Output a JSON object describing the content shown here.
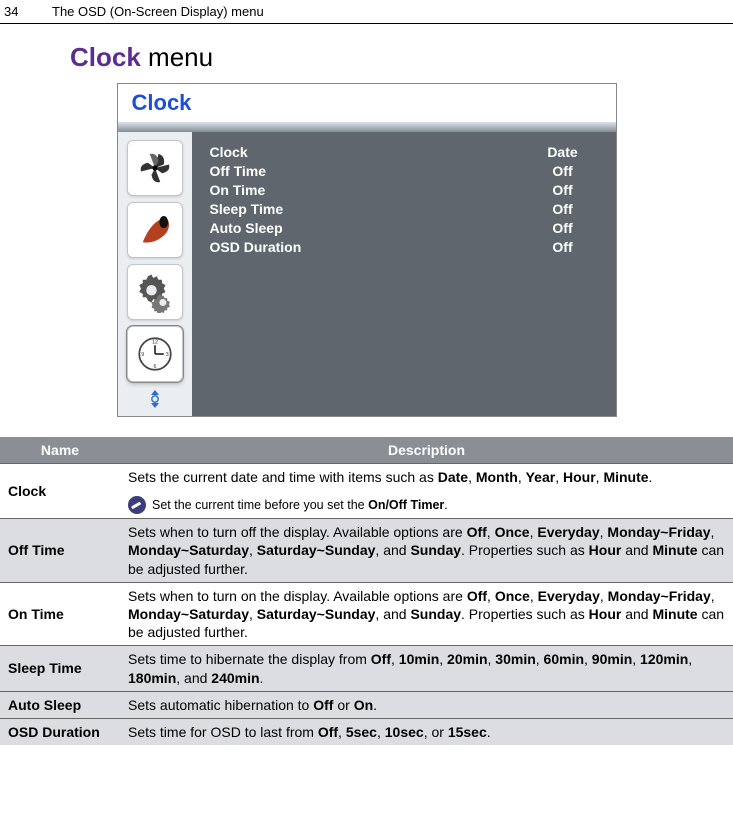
{
  "header": {
    "page_number": "34",
    "chapter": "The OSD (On-Screen Display) menu"
  },
  "section": {
    "accent": "Clock",
    "rest": " menu"
  },
  "osd": {
    "title": "Clock",
    "icons": [
      "fan-icon",
      "calibration-icon",
      "settings-icon",
      "clock-icon"
    ],
    "items": [
      {
        "label": "Clock",
        "value": "Date"
      },
      {
        "label": "Off Time",
        "value": "Off"
      },
      {
        "label": "On Time",
        "value": "Off"
      },
      {
        "label": "Sleep Time",
        "value": "Off"
      },
      {
        "label": "Auto Sleep",
        "value": "Off"
      },
      {
        "label": "OSD Duration",
        "value": "Off"
      }
    ]
  },
  "table": {
    "headers": {
      "name": "Name",
      "description": "Description"
    },
    "rows": [
      {
        "name": "Clock",
        "desc_parts": [
          "Sets the current date and time with items such as ",
          "Date",
          ", ",
          "Month",
          ", ",
          "Year",
          ", ",
          "Hour",
          ", ",
          "Minute",
          "."
        ],
        "note_parts": [
          "Set the current time before you set the ",
          "On/Off Timer",
          "."
        ]
      },
      {
        "name": "Off Time",
        "desc_parts": [
          "Sets when to turn off the display. Available options are ",
          "Off",
          ", ",
          "Once",
          ", ",
          "Everyday",
          ", ",
          "Monday~Friday",
          ", ",
          "Monday~Saturday",
          ", ",
          "Saturday~Sunday",
          ", and ",
          "Sunday",
          ". Properties such as ",
          "Hour",
          " and ",
          "Minute",
          " can be adjusted further."
        ]
      },
      {
        "name": "On Time",
        "desc_parts": [
          "Sets when to turn on the display. Available options are ",
          "Off",
          ", ",
          "Once",
          ", ",
          "Everyday",
          ", ",
          "Monday~Friday",
          ", ",
          "Monday~Saturday",
          ", ",
          "Saturday~Sunday",
          ", and ",
          "Sunday",
          ". Properties such as ",
          "Hour",
          " and ",
          "Minute",
          " can be adjusted further."
        ]
      },
      {
        "name": "Sleep Time",
        "desc_parts": [
          "Sets time to hibernate the display from ",
          "Off",
          ", ",
          "10min",
          ", ",
          "20min",
          ", ",
          "30min",
          ", ",
          "60min",
          ", ",
          "90min",
          ", ",
          "120min",
          ", ",
          "180min",
          ", and ",
          "240min",
          "."
        ]
      },
      {
        "name": "Auto Sleep",
        "desc_parts": [
          "Sets automatic hibernation to ",
          "Off",
          " or ",
          "On",
          "."
        ]
      },
      {
        "name": "OSD Duration",
        "desc_parts": [
          "Sets time for OSD to last from ",
          "Off",
          ", ",
          "5sec",
          ", ",
          "10sec",
          ", or ",
          "15sec",
          "."
        ]
      }
    ]
  }
}
